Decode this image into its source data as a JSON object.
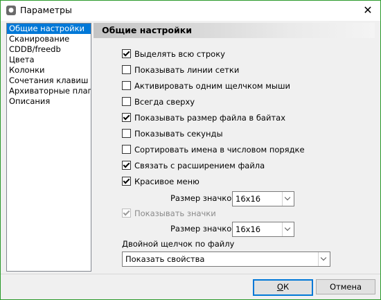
{
  "window": {
    "title": "Параметры",
    "close_glyph": "✕",
    "app_icon": "cat-app-icon"
  },
  "sidebar": {
    "items": [
      {
        "label": "Общие настройки",
        "active": true
      },
      {
        "label": "Сканирование"
      },
      {
        "label": "CDDB/freedb"
      },
      {
        "label": "Цвета"
      },
      {
        "label": "Колонки"
      },
      {
        "label": "Сочетания клавиш"
      },
      {
        "label": "Архиваторные плагин"
      },
      {
        "label": "Описания"
      }
    ]
  },
  "page": {
    "title": "Общие настройки",
    "checkboxes": [
      {
        "label": "Выделять всю строку",
        "checked": true
      },
      {
        "label": "Показывать линии сетки",
        "checked": false
      },
      {
        "label": "Активировать одним щелчком мыши",
        "checked": false
      },
      {
        "label": "Всегда сверху",
        "checked": false
      },
      {
        "label": "Показывать размер файла в байтах",
        "checked": true
      },
      {
        "label": "Показывать секунды",
        "checked": false
      },
      {
        "label": "Сортировать имена в числовом порядке",
        "checked": false
      },
      {
        "label": "Связать с расширением файла",
        "checked": true
      },
      {
        "label": "Красивое меню",
        "checked": true
      }
    ],
    "menu_icon_size": {
      "label": "Размер значков",
      "value": "16x16"
    },
    "show_icons": {
      "label": "Показывать значки",
      "checked": true,
      "disabled": true
    },
    "icon_size": {
      "label": "Размер значков",
      "value": "16x16"
    },
    "double_click": {
      "label": "Двойной щелчок по файлу",
      "value": "Показать свойства"
    }
  },
  "buttons": {
    "ok": {
      "label": "ОК",
      "mnemonic": "О",
      "rest": "К"
    },
    "cancel": {
      "label": "Отмена"
    }
  }
}
